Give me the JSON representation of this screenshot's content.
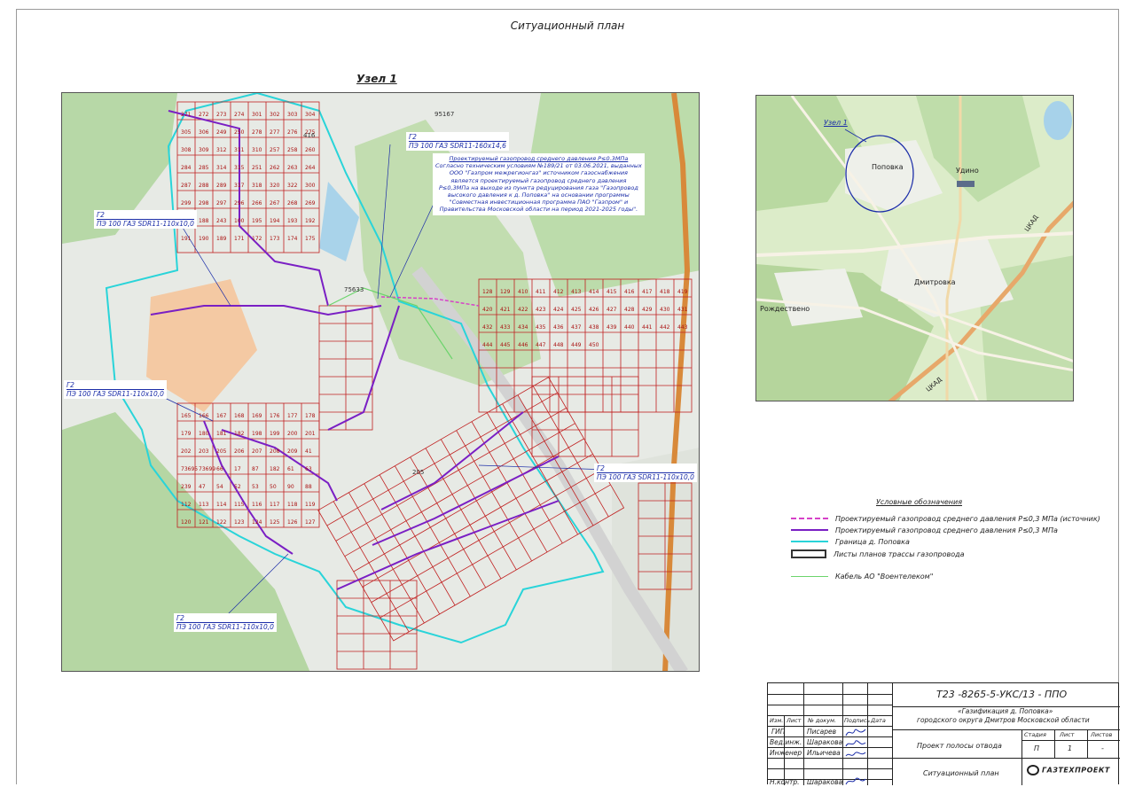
{
  "sheet": {
    "title": "Ситуационный план",
    "node_title": "Узел 1"
  },
  "map": {
    "plot_labels": [
      "271",
      "272",
      "273",
      "274",
      "301",
      "302",
      "303",
      "304",
      "305",
      "306",
      "249",
      "250",
      "278",
      "277",
      "276",
      "275",
      "308",
      "309",
      "312",
      "311",
      "310",
      "257",
      "258",
      "260",
      "284",
      "285",
      "314",
      "315",
      "251",
      "262",
      "263",
      "264",
      "287",
      "288",
      "289",
      "317",
      "318",
      "320",
      "322",
      "300",
      "299",
      "298",
      "297",
      "296",
      "266",
      "267",
      "268",
      "269",
      "33",
      "188",
      "243",
      "100",
      "195",
      "194",
      "193",
      "192",
      "191",
      "190",
      "189",
      "171",
      "172",
      "173",
      "174",
      "175",
      "165",
      "166",
      "167",
      "168",
      "169",
      "176",
      "177",
      "178",
      "179",
      "180",
      "181",
      "182",
      "198",
      "199",
      "200",
      "201",
      "202",
      "203",
      "205",
      "206",
      "207",
      "208",
      "209",
      "41",
      "73695",
      "73699",
      "66",
      "17",
      "87",
      "182",
      "61",
      "63",
      "239",
      "47",
      "54",
      "52",
      "53",
      "50",
      "90",
      "88",
      "112",
      "113",
      "114",
      "115",
      "116",
      "117",
      "118",
      "119",
      "120",
      "121",
      "122",
      "123",
      "124",
      "125",
      "126",
      "127",
      "128",
      "129",
      "410",
      "411",
      "412",
      "413",
      "414",
      "415",
      "416",
      "417",
      "418",
      "419",
      "420",
      "421",
      "422",
      "423",
      "424",
      "425",
      "426",
      "427",
      "428",
      "429",
      "430",
      "431",
      "432",
      "433",
      "434",
      "435",
      "436",
      "437",
      "438",
      "439",
      "440",
      "441",
      "442",
      "443",
      "444",
      "445",
      "446",
      "447",
      "448",
      "449",
      "450"
    ],
    "area_labels": [
      "95167",
      "75633",
      "416",
      "205"
    ],
    "callouts": [
      {
        "line1": "Г2",
        "line2": "ПЭ 100 ГАЗ SDR11-160х14,6"
      },
      {
        "line1": "Г2",
        "line2": "ПЭ 100 ГАЗ SDR11-110х10,0"
      },
      {
        "line1": "Г2",
        "line2": "ПЭ 100 ГАЗ SDR11-110х10,0"
      },
      {
        "line1": "Г2",
        "line2": "ПЭ 100 ГАЗ SDR11-110х10,0"
      },
      {
        "line1": "Г2",
        "line2": "ПЭ 100 ГАЗ SDR11-110х10,0"
      }
    ],
    "note": [
      "Проектируемый газопровод среднего давления P≤0.3МПа",
      "Согласно техническим условиям №189/21 от 03.06.2021, выданных",
      "ООО \"Газпром межрегионгаз\" источником газоснабжения",
      "является проектируемый газопровод среднего давления",
      "P≤0,3МПа на выходе из пункта редуцирования газа \"Газопровод",
      "высокого давления к д. Поповка\" на основании программы",
      "\"Совместная инвестиционная программа ПАО \"Газпром\" и",
      "Правительства Московской области на период 2021-2025 годы\"."
    ]
  },
  "inset": {
    "labels": {
      "node": "Узел 1",
      "village": "Поповка",
      "udino": "Удино",
      "rozhdestveno": "Рождествено",
      "dmitrovka": "Дмитровка",
      "road1": "ЦКАД",
      "road2": "ЦКАД"
    }
  },
  "legend": {
    "title": "Условные обозначения",
    "items": [
      {
        "label": "Проектируемый газопровод среднего давления P≤0,3 МПа (источник)",
        "color": "#d642c8"
      },
      {
        "label": "Проектируемый газопровод среднего давления P≤0,3 МПа",
        "color": "#7a1fc4"
      },
      {
        "label": "Граница д. Поповка",
        "color": "#29d4d9"
      },
      {
        "label": "Листы планов трассы газопровода",
        "color": "#333333"
      },
      {
        "label": "Кабель АО \"Воентелеком\"",
        "color": "#6cd46c"
      }
    ]
  },
  "stamp": {
    "code": "Т23 -8265-5-УКС/13 - ППО",
    "object_line1": "«Газификация д. Поповка»",
    "object_line2": "городского округа Дмитров Московской области",
    "section": "Проект полосы отвода",
    "sheet_name": "Ситуационный план",
    "col_headers": [
      "Изм.",
      "Лист",
      "№ докум.",
      "Подпись",
      "Дата"
    ],
    "stage_headers": [
      "Стадия",
      "Лист",
      "Листов"
    ],
    "stage_values": [
      "П",
      "1",
      "-"
    ],
    "roles": [
      {
        "role": "ГИП",
        "name": "Писарев"
      },
      {
        "role": "Вед.инж.",
        "name": "Шаракова"
      },
      {
        "role": "Инженер",
        "name": "Ильичева"
      },
      {
        "role": "Н.контр.",
        "name": "Шаракова"
      }
    ],
    "company": "ГАЗТЕХПРОЕКТ"
  }
}
